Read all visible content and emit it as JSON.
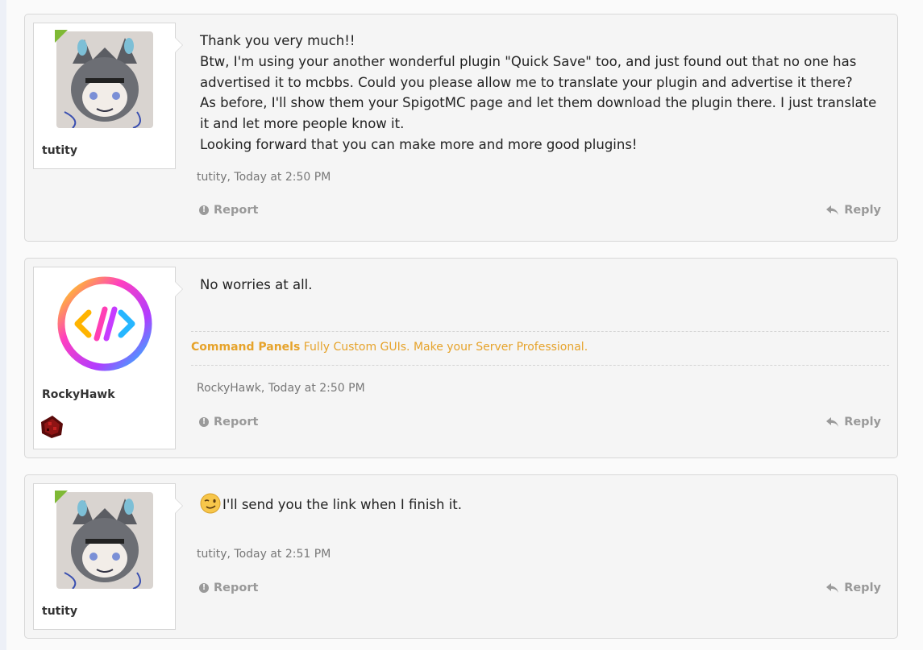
{
  "posts": [
    {
      "username": "tutity",
      "online": true,
      "message_lines": [
        "Thank you very much!!",
        "Btw, I'm using your another wonderful plugin \"Quick Save\" too, and just found out that no one has",
        "advertised it to mcbbs. Could you please allow me to translate your plugin and advertise it there?",
        "As before, I'll show them your SpigotMC page and let them download the plugin there. I just translate",
        "it and let more people know it.",
        "Looking forward that you can make more and more good plugins!"
      ],
      "meta": "tutity, Today at 2:50 PM",
      "report_label": "Report",
      "reply_label": "Reply"
    },
    {
      "username": "RockyHawk",
      "online": false,
      "message_lines": [
        "No worries at all."
      ],
      "signature_title": "Command Panels",
      "signature_text": "Fully Custom GUIs. Make your Server Professional.",
      "meta": "RockyHawk, Today at 2:50 PM",
      "report_label": "Report",
      "reply_label": "Reply",
      "badge_icon": "redstone-dust-icon"
    },
    {
      "username": "tutity",
      "online": true,
      "message_lines": [
        "I'll send you the link when I finish it."
      ],
      "emoji": "wink-emoji-icon",
      "meta": "tutity, Today at 2:51 PM",
      "report_label": "Report",
      "reply_label": "Reply"
    }
  ],
  "colors": {
    "online_marker": "#7fb935",
    "signature": "#e6a32b",
    "meta_text": "#777777",
    "action_text": "#999999"
  }
}
